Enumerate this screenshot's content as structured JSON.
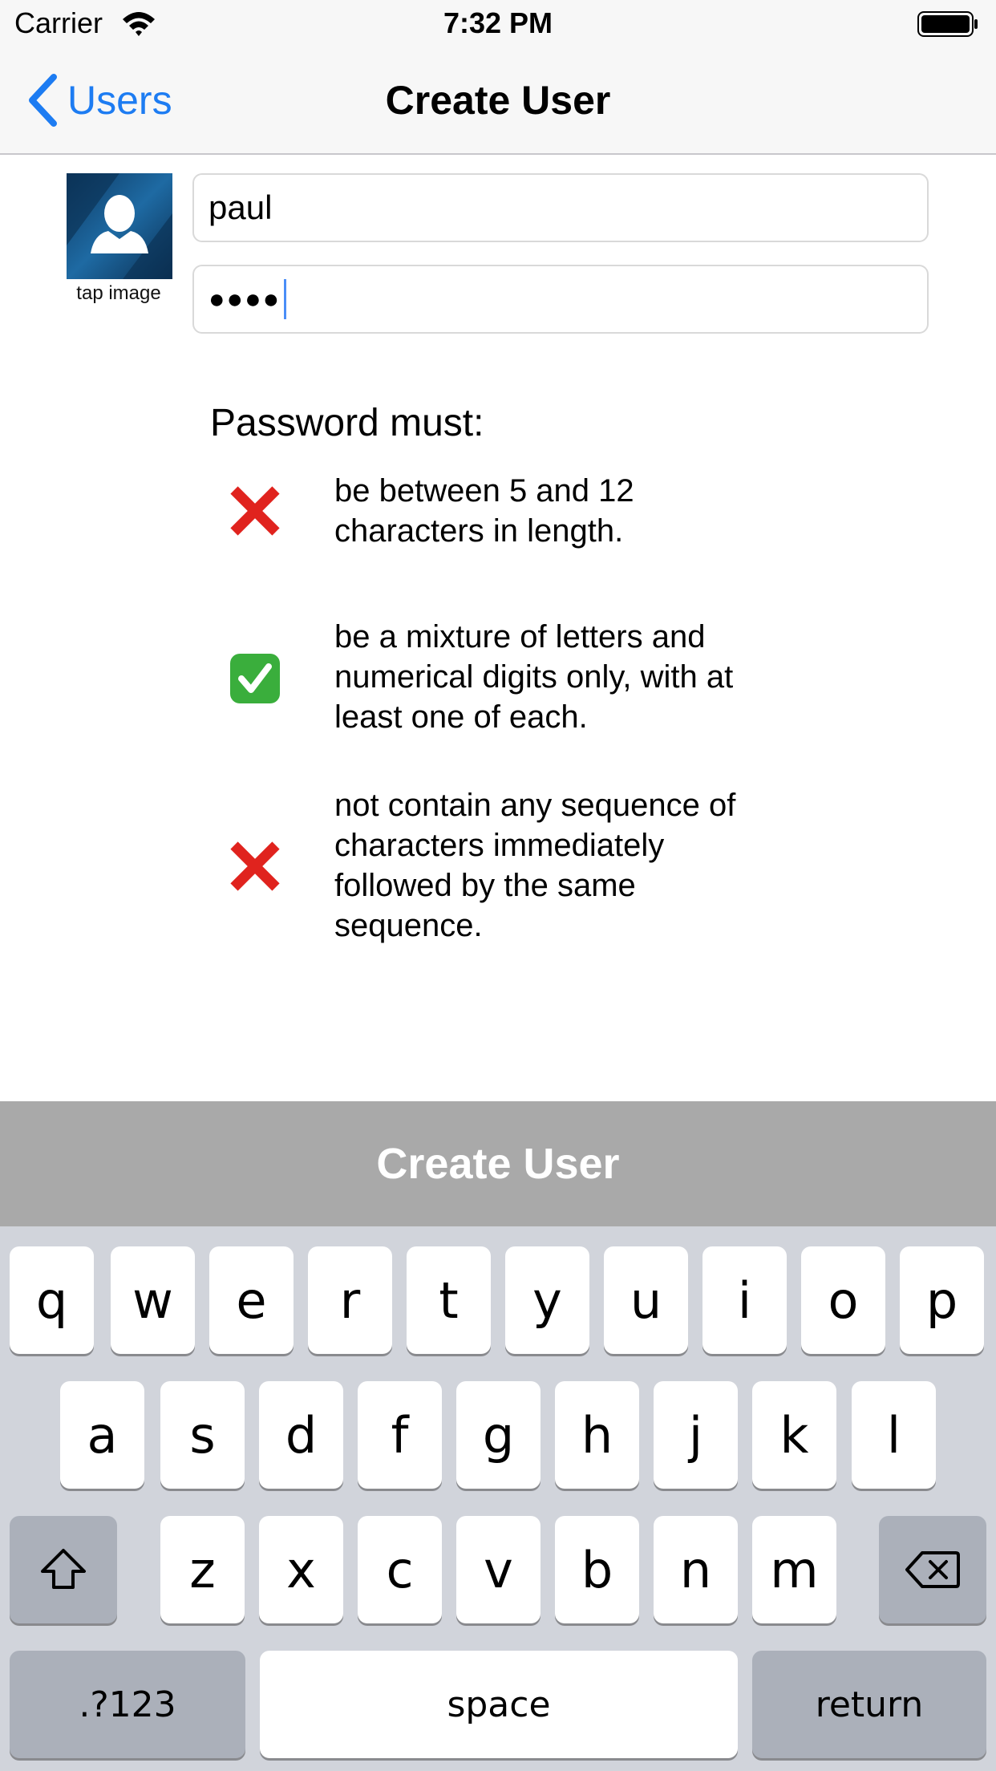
{
  "status_bar": {
    "carrier": "Carrier",
    "time": "7:32 PM"
  },
  "nav": {
    "back_label": "Users",
    "title": "Create User"
  },
  "form": {
    "avatar_caption": "tap image",
    "username_value": "paul",
    "password_value": "●●●●"
  },
  "rules": {
    "heading": "Password must:",
    "items": [
      {
        "status": "fail",
        "icon": "cross-mark-icon",
        "text": "be between 5 and 12 characters in length."
      },
      {
        "status": "pass",
        "icon": "check-mark-icon",
        "text": "be a mixture of letters and numerical digits only, with at least one of each."
      },
      {
        "status": "fail",
        "icon": "cross-mark-icon",
        "text": "not contain any sequence of characters immediately followed by the same sequence."
      }
    ]
  },
  "create_button": {
    "label": "Create User"
  },
  "keyboard": {
    "row1": [
      "q",
      "w",
      "e",
      "r",
      "t",
      "y",
      "u",
      "i",
      "o",
      "p"
    ],
    "row2": [
      "a",
      "s",
      "d",
      "f",
      "g",
      "h",
      "j",
      "k",
      "l"
    ],
    "row3": [
      "z",
      "x",
      "c",
      "v",
      "b",
      "n",
      "m"
    ],
    "numbers_label": ".?123",
    "space_label": "space",
    "return_label": "return"
  },
  "colors": {
    "accent": "#1d7cf2",
    "fail": "#e0231e",
    "pass": "#3aae3c",
    "button_disabled": "#a9a9a9"
  }
}
